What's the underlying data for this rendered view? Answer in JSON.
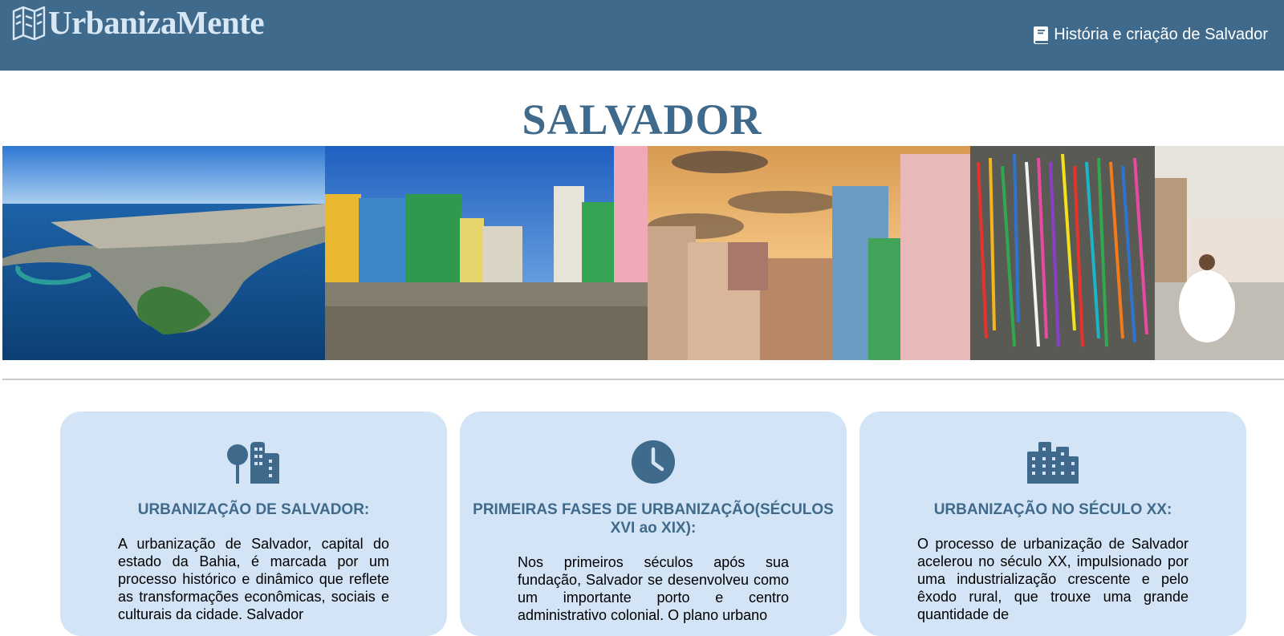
{
  "header": {
    "logo_text": "UrbanizaMente",
    "nav_link_label": "História e criação de Salvador"
  },
  "page": {
    "title": "SALVADOR"
  },
  "gallery": {
    "photos": [
      {
        "icon": "aerial-coast-photo"
      },
      {
        "icon": "colorful-houses-photo"
      },
      {
        "icon": "sunset-churches-photo"
      },
      {
        "icon": "ribbons-fence-photo"
      }
    ]
  },
  "cards": [
    {
      "icon": "city-tree-icon",
      "title": "URBANIZAÇÃO DE SALVADOR:",
      "text": "A urbanização de Salvador, capital do estado da Bahia, é marcada por um processo histórico e dinâmico que reflete as transformações econômicas, sociais e culturais da cidade. Salvador"
    },
    {
      "icon": "clock-icon",
      "title": "PRIMEIRAS FASES DE URBANIZAÇÃO(SÉCULOS XVI ao XIX):",
      "text": "Nos primeiros séculos após sua fundação, Salvador se desenvolveu como um importante porto e centro administrativo colonial. O plano urbano"
    },
    {
      "icon": "building-icon",
      "title": "URBANIZAÇÃO NO SÉCULO XX:",
      "text": "O processo de urbanização de Salvador acelerou no século XX, impulsionado por uma industrialização crescente e pelo êxodo rural, que trouxe uma grande quantidade de"
    }
  ]
}
